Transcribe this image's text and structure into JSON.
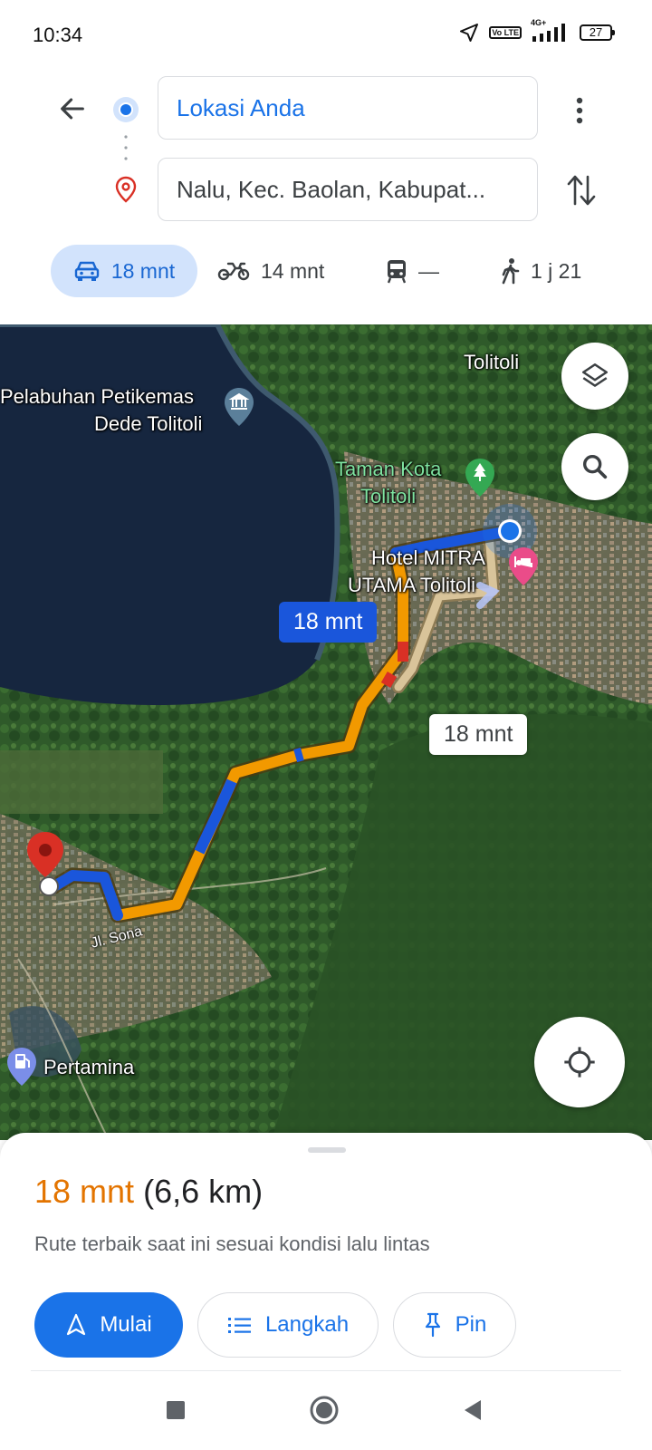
{
  "status_bar": {
    "time": "10:34",
    "network": "4G+",
    "volte": "Vo LTE",
    "battery": "27"
  },
  "search": {
    "origin": "Lokasi Anda",
    "destination": "Nalu, Kec. Baolan, Kabupat..."
  },
  "travel_modes": [
    {
      "name": "car",
      "time": "18 mnt",
      "selected": true
    },
    {
      "name": "motorcycle",
      "time": "14 mnt"
    },
    {
      "name": "transit",
      "time": "—"
    },
    {
      "name": "walk",
      "time": "1 j 21"
    }
  ],
  "map": {
    "labels": {
      "tolitoli": "Tolitoli",
      "port_line1": "Pelabuhan Petikemas",
      "port_line2": "Dede Tolitoli",
      "park_line1": "Taman Kota",
      "park_line2": "Tolitoli",
      "hotel_line1": "Hotel MITRA",
      "hotel_line2": "UTAMA Tolitoli",
      "road": "Jl. Sona",
      "fuel": "Pertamina"
    },
    "route_badge_primary": "18 mnt",
    "route_badge_alt": "18 mnt",
    "colors": {
      "route_fast": "#1a56db",
      "route_slow": "#f29900",
      "route_jam": "#d93025",
      "route_alt": "#d9c49a",
      "water": "#16263f"
    }
  },
  "sheet": {
    "eta_time": "18 mnt",
    "eta_distance": "(6,6 km)",
    "description": "Rute terbaik saat ini sesuai kondisi lalu lintas",
    "buttons": {
      "start": "Mulai",
      "steps": "Langkah",
      "pin": "Pin"
    }
  },
  "colors": {
    "accent": "#1a73e8",
    "eta": "#e37400"
  }
}
